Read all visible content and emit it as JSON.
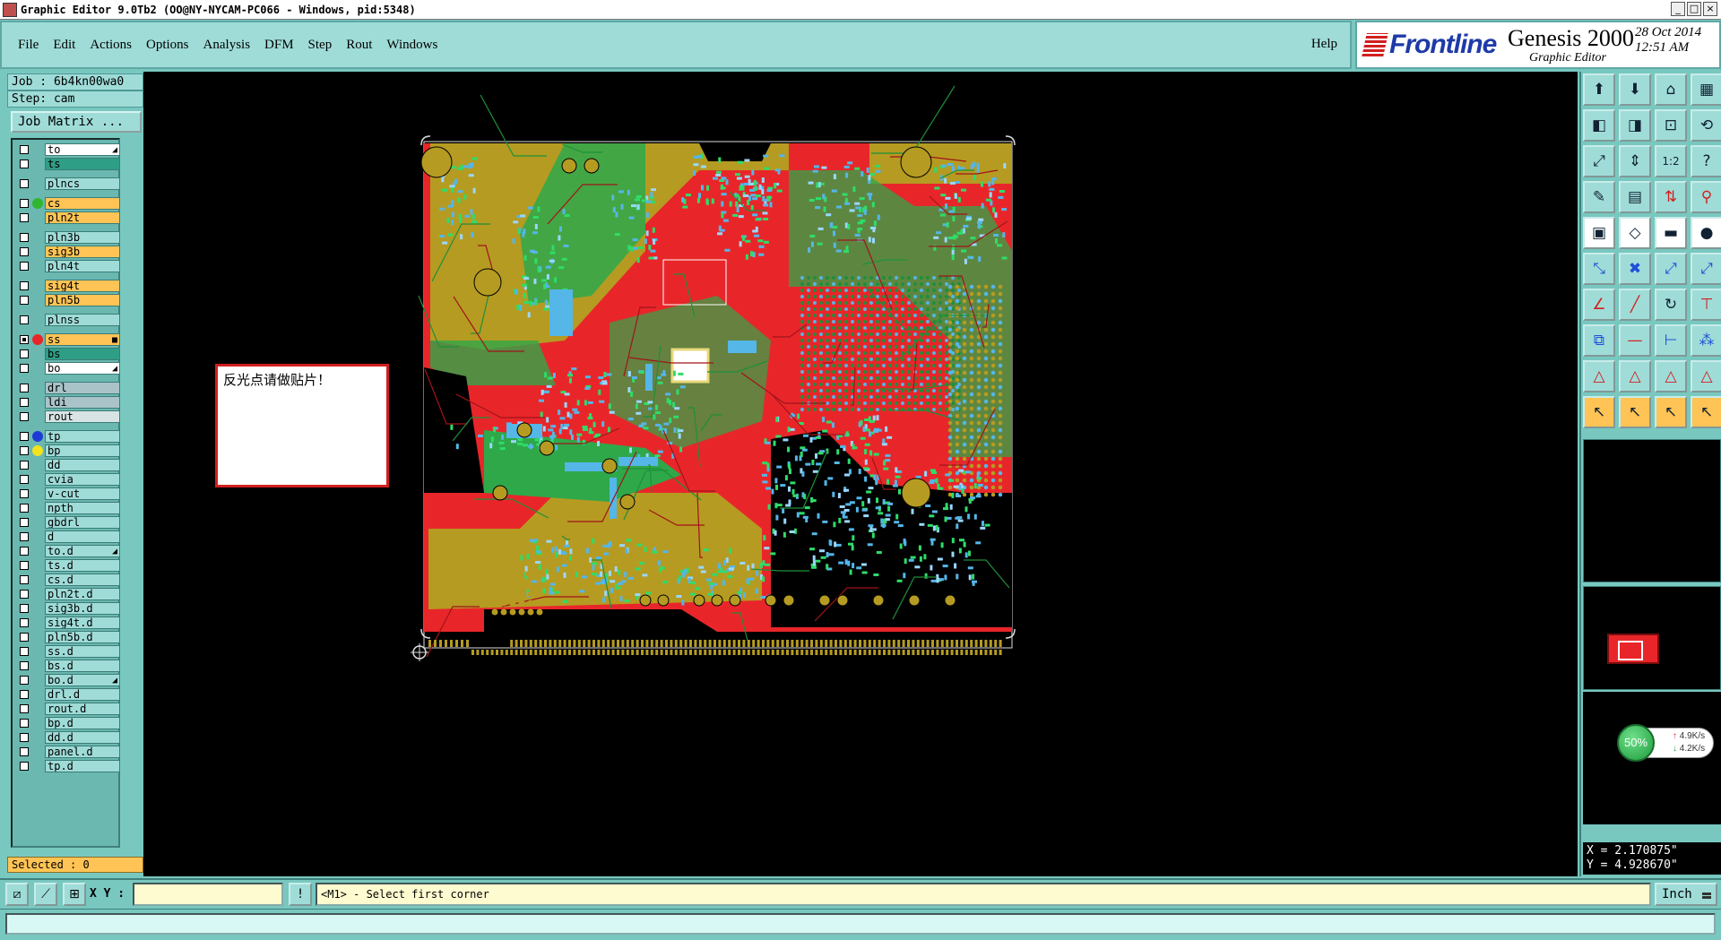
{
  "window": {
    "title": "Graphic Editor 9.0Tb2 (OO@NY-NYCAM-PC066 - Windows, pid:5348)",
    "buttons": [
      "_",
      "□",
      "×"
    ]
  },
  "menu": {
    "items": [
      "File",
      "Edit",
      "Actions",
      "Options",
      "Analysis",
      "DFM",
      "Step",
      "Rout",
      "Windows"
    ],
    "help": "Help"
  },
  "brand": {
    "logo": "Frontline",
    "product": "Genesis 2000",
    "subtitle": "Graphic Editor",
    "date": "28 Oct 2014",
    "time": "12:51 AM"
  },
  "job": {
    "job_line": "Job : 6b4kn00wa0",
    "step_line": "Step: cam",
    "matrix_button": "Job Matrix ..."
  },
  "layers": [
    {
      "name": "to",
      "color": "#ffffff",
      "checked": false,
      "dot": "",
      "mark": "◢"
    },
    {
      "name": "ts",
      "color": "#2f9e86",
      "checked": false,
      "dot": "",
      "mark": ""
    },
    {
      "name": "plncs",
      "color": "#9fdcd8",
      "checked": false,
      "dot": "",
      "mark": ""
    },
    {
      "name": "cs",
      "color": "#ffc455",
      "checked": false,
      "dot": "#2fb52f",
      "mark": ""
    },
    {
      "name": "pln2t",
      "color": "#ffc455",
      "checked": false,
      "dot": "",
      "mark": ""
    },
    {
      "name": "pln3b",
      "color": "#9fdcd8",
      "checked": false,
      "dot": "",
      "mark": ""
    },
    {
      "name": "sig3b",
      "color": "#ffc455",
      "checked": false,
      "dot": "",
      "mark": ""
    },
    {
      "name": "pln4t",
      "color": "#9fdcd8",
      "checked": false,
      "dot": "",
      "mark": ""
    },
    {
      "name": "sig4t",
      "color": "#ffc455",
      "checked": false,
      "dot": "",
      "mark": ""
    },
    {
      "name": "pln5b",
      "color": "#ffc455",
      "checked": false,
      "dot": "",
      "mark": ""
    },
    {
      "name": "plnss",
      "color": "#9fdcd8",
      "checked": false,
      "dot": "",
      "mark": ""
    },
    {
      "name": "ss",
      "color": "#ffc455",
      "checked": true,
      "dot": "#e8262a",
      "mark": "■"
    },
    {
      "name": "bs",
      "color": "#2f9e86",
      "checked": false,
      "dot": "",
      "mark": ""
    },
    {
      "name": "bo",
      "color": "#ffffff",
      "checked": false,
      "dot": "",
      "mark": "◢"
    },
    {
      "name": "drl",
      "color": "#a9c3c9",
      "checked": false,
      "dot": "",
      "mark": ""
    },
    {
      "name": "ldi",
      "color": "#a9c3c9",
      "checked": false,
      "dot": "",
      "mark": ""
    },
    {
      "name": "rout",
      "color": "#d8e4e4",
      "checked": false,
      "dot": "",
      "mark": ""
    },
    {
      "name": "tp",
      "color": "#9fdcd8",
      "checked": false,
      "dot": "#1e3ad6",
      "mark": ""
    },
    {
      "name": "bp",
      "color": "#9fdcd8",
      "checked": false,
      "dot": "#f3e21e",
      "mark": ""
    },
    {
      "name": "dd",
      "color": "#9fdcd8",
      "checked": false,
      "dot": "",
      "mark": ""
    },
    {
      "name": "cvia",
      "color": "#9fdcd8",
      "checked": false,
      "dot": "",
      "mark": ""
    },
    {
      "name": "v-cut",
      "color": "#9fdcd8",
      "checked": false,
      "dot": "",
      "mark": ""
    },
    {
      "name": "npth",
      "color": "#9fdcd8",
      "checked": false,
      "dot": "",
      "mark": ""
    },
    {
      "name": "gbdrl",
      "color": "#9fdcd8",
      "checked": false,
      "dot": "",
      "mark": ""
    },
    {
      "name": "d",
      "color": "#9fdcd8",
      "checked": false,
      "dot": "",
      "mark": ""
    },
    {
      "name": "to.d",
      "color": "#9fdcd8",
      "checked": false,
      "dot": "",
      "mark": "◢"
    },
    {
      "name": "ts.d",
      "color": "#9fdcd8",
      "checked": false,
      "dot": "",
      "mark": ""
    },
    {
      "name": "cs.d",
      "color": "#9fdcd8",
      "checked": false,
      "dot": "",
      "mark": ""
    },
    {
      "name": "pln2t.d",
      "color": "#9fdcd8",
      "checked": false,
      "dot": "",
      "mark": ""
    },
    {
      "name": "sig3b.d",
      "color": "#9fdcd8",
      "checked": false,
      "dot": "",
      "mark": ""
    },
    {
      "name": "sig4t.d",
      "color": "#9fdcd8",
      "checked": false,
      "dot": "",
      "mark": ""
    },
    {
      "name": "pln5b.d",
      "color": "#9fdcd8",
      "checked": false,
      "dot": "",
      "mark": ""
    },
    {
      "name": "ss.d",
      "color": "#9fdcd8",
      "checked": false,
      "dot": "",
      "mark": ""
    },
    {
      "name": "bs.d",
      "color": "#9fdcd8",
      "checked": false,
      "dot": "",
      "mark": ""
    },
    {
      "name": "bo.d",
      "color": "#9fdcd8",
      "checked": false,
      "dot": "",
      "mark": "◢"
    },
    {
      "name": "drl.d",
      "color": "#9fdcd8",
      "checked": false,
      "dot": "",
      "mark": ""
    },
    {
      "name": "rout.d",
      "color": "#9fdcd8",
      "checked": false,
      "dot": "",
      "mark": ""
    },
    {
      "name": "bp.d",
      "color": "#9fdcd8",
      "checked": false,
      "dot": "",
      "mark": ""
    },
    {
      "name": "dd.d",
      "color": "#9fdcd8",
      "checked": false,
      "dot": "",
      "mark": ""
    },
    {
      "name": "panel.d",
      "color": "#9fdcd8",
      "checked": false,
      "dot": "",
      "mark": ""
    },
    {
      "name": "tp.d",
      "color": "#9fdcd8",
      "checked": false,
      "dot": "",
      "mark": ""
    }
  ],
  "selected_label": "Selected : 0",
  "note_text": "反光点请做贴片！",
  "toolbar": [
    {
      "name": "open-step-icon",
      "glyph": "⬆",
      "style": ""
    },
    {
      "name": "save-step-icon",
      "glyph": "⬇",
      "style": ""
    },
    {
      "name": "home-icon",
      "glyph": "⌂",
      "style": ""
    },
    {
      "name": "window-split-icon",
      "glyph": "▦",
      "style": ""
    },
    {
      "name": "pan-left-icon",
      "glyph": "◧",
      "style": ""
    },
    {
      "name": "pan-right-icon",
      "glyph": "◨",
      "style": ""
    },
    {
      "name": "zoom-fit-icon",
      "glyph": "⊡",
      "style": ""
    },
    {
      "name": "redraw-icon",
      "glyph": "⟲",
      "style": ""
    },
    {
      "name": "zoom-home-icon",
      "glyph": "⤢",
      "style": ""
    },
    {
      "name": "zoom-in-out-icon",
      "glyph": "⇕",
      "style": ""
    },
    {
      "name": "scale-1-2-icon",
      "glyph": "1:2",
      "style": ""
    },
    {
      "name": "query-icon",
      "glyph": "?",
      "style": ""
    },
    {
      "name": "snapshot-icon",
      "glyph": "✎",
      "style": ""
    },
    {
      "name": "grid-icon",
      "glyph": "▤",
      "style": ""
    },
    {
      "name": "measure-icon",
      "glyph": "⇅",
      "style": "redfg"
    },
    {
      "name": "net-icon",
      "glyph": "⚲",
      "style": "redfg"
    },
    {
      "name": "add-pad-icon",
      "glyph": "▣",
      "style": "white"
    },
    {
      "name": "add-line-icon",
      "glyph": "◇",
      "style": "white"
    },
    {
      "name": "add-text-icon",
      "glyph": "▬",
      "style": "white"
    },
    {
      "name": "add-round-icon",
      "glyph": "●",
      "style": "white"
    },
    {
      "name": "move-icon",
      "glyph": "⤡",
      "style": "blue"
    },
    {
      "name": "delete-icon",
      "glyph": "✖",
      "style": "blue"
    },
    {
      "name": "copy-icon",
      "glyph": "⤢",
      "style": "blue"
    },
    {
      "name": "stretch-icon",
      "glyph": "⤢",
      "style": "blue"
    },
    {
      "name": "edit-line-icon",
      "glyph": "∠",
      "style": "redfg"
    },
    {
      "name": "edit-segment-icon",
      "glyph": "╱",
      "style": "redfg"
    },
    {
      "name": "arc-icon",
      "glyph": "↻",
      "style": ""
    },
    {
      "name": "split-icon",
      "glyph": "⊤",
      "style": "redfg"
    },
    {
      "name": "resize-icon",
      "glyph": "⧉",
      "style": "blue"
    },
    {
      "name": "break-icon",
      "glyph": "—",
      "style": "redfg"
    },
    {
      "name": "align-icon",
      "glyph": "⊢",
      "style": "blue"
    },
    {
      "name": "pads-icon",
      "glyph": "⁂",
      "style": "blue"
    },
    {
      "name": "surface-icon",
      "glyph": "△",
      "style": "redfg"
    },
    {
      "name": "surface-add-icon",
      "glyph": "△",
      "style": "redfg"
    },
    {
      "name": "surface-edit-icon",
      "glyph": "△",
      "style": "redfg"
    },
    {
      "name": "surface-hole-icon",
      "glyph": "△",
      "style": "redfg"
    },
    {
      "name": "pointer-icon",
      "glyph": "↖",
      "style": "orange"
    },
    {
      "name": "pointer-select-icon",
      "glyph": "↖",
      "style": "orange"
    },
    {
      "name": "pointer-box-icon",
      "glyph": "↖",
      "style": "orange"
    },
    {
      "name": "pointer-net-icon",
      "glyph": "↖",
      "style": "orange"
    }
  ],
  "speed": {
    "percent": "50%",
    "up": "4.9K/s",
    "down": "4.2K/s"
  },
  "coords": {
    "x": "X = 2.170875\"",
    "y": "Y = 4.928670\""
  },
  "status": {
    "xy_label": "X Y :",
    "xy_value": "",
    "info_button": "!",
    "message": "<M1> - Select first corner",
    "unit": "Inch"
  },
  "colors": {
    "copper_red": "#e8262a",
    "copper_green": "#2fa84a",
    "olive": "#b59b21",
    "pad_cyan": "#55b6e8",
    "accent_teal": "#78c8c0"
  }
}
